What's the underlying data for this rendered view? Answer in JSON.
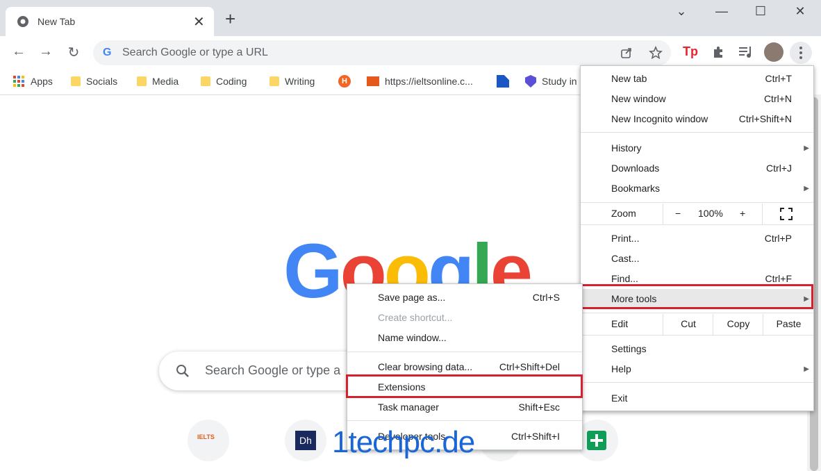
{
  "browser": {
    "tab": {
      "title": "New Tab",
      "close": "✕"
    },
    "new_tab_symbol": "+",
    "window_controls": [
      "⌄",
      "—",
      "☐",
      "✕"
    ]
  },
  "toolbar": {
    "back": "←",
    "forward": "→",
    "reload": "↻",
    "omnibox_placeholder": "Search Google or type a URL",
    "omnibox_icon": "G"
  },
  "bookmarks": [
    {
      "label": "Apps",
      "icon": "apps-grid-icon"
    },
    {
      "label": "Socials",
      "icon": "folder-icon"
    },
    {
      "label": "Media",
      "icon": "folder-icon"
    },
    {
      "label": "Coding",
      "icon": "folder-icon"
    },
    {
      "label": "Writing",
      "icon": "folder-icon"
    },
    {
      "label": "",
      "icon": "site-h-icon"
    },
    {
      "label": "https://ieltsonline.c...",
      "icon": "ielts-icon"
    },
    {
      "label": "",
      "icon": "blue-bookmark-icon"
    },
    {
      "label": "Study in",
      "icon": "shield-icon"
    }
  ],
  "content": {
    "logo": "Google",
    "search_placeholder": "Search Google or type a"
  },
  "main_menu": {
    "items": [
      {
        "label": "New tab",
        "key": "Ctrl+T"
      },
      {
        "label": "New window",
        "key": "Ctrl+N"
      },
      {
        "label": "New Incognito window",
        "key": "Ctrl+Shift+N"
      },
      {
        "label": "History",
        "key": ""
      },
      {
        "label": "Downloads",
        "key": "Ctrl+J"
      },
      {
        "label": "Bookmarks",
        "key": ""
      },
      {
        "label": "Print...",
        "key": "Ctrl+P"
      },
      {
        "label": "Cast...",
        "key": ""
      },
      {
        "label": "Find...",
        "key": "Ctrl+F"
      },
      {
        "label": "More tools",
        "key": ""
      },
      {
        "label": "Settings",
        "key": ""
      },
      {
        "label": "Help",
        "key": ""
      },
      {
        "label": "Exit",
        "key": ""
      }
    ],
    "zoom": {
      "label": "Zoom",
      "minus": "−",
      "value": "100%",
      "plus": "+"
    },
    "edit": {
      "label": "Edit",
      "cut": "Cut",
      "copy": "Copy",
      "paste": "Paste"
    }
  },
  "submenu": {
    "items": [
      {
        "label": "Save page as...",
        "key": "Ctrl+S"
      },
      {
        "label": "Create shortcut...",
        "key": ""
      },
      {
        "label": "Name window...",
        "key": ""
      },
      {
        "label": "Clear browsing data...",
        "key": "Ctrl+Shift+Del"
      },
      {
        "label": "Extensions",
        "key": ""
      },
      {
        "label": "Task manager",
        "key": "Shift+Esc"
      },
      {
        "label": "Developer tools",
        "key": "Ctrl+Shift+I"
      }
    ]
  },
  "shortcuts": [
    {
      "label": "IELTS"
    },
    {
      "label": "Dh"
    }
  ],
  "watermark": "1techpc.de",
  "colors": {
    "highlight_box": "#d6202f",
    "accent": "#1a73e8"
  }
}
